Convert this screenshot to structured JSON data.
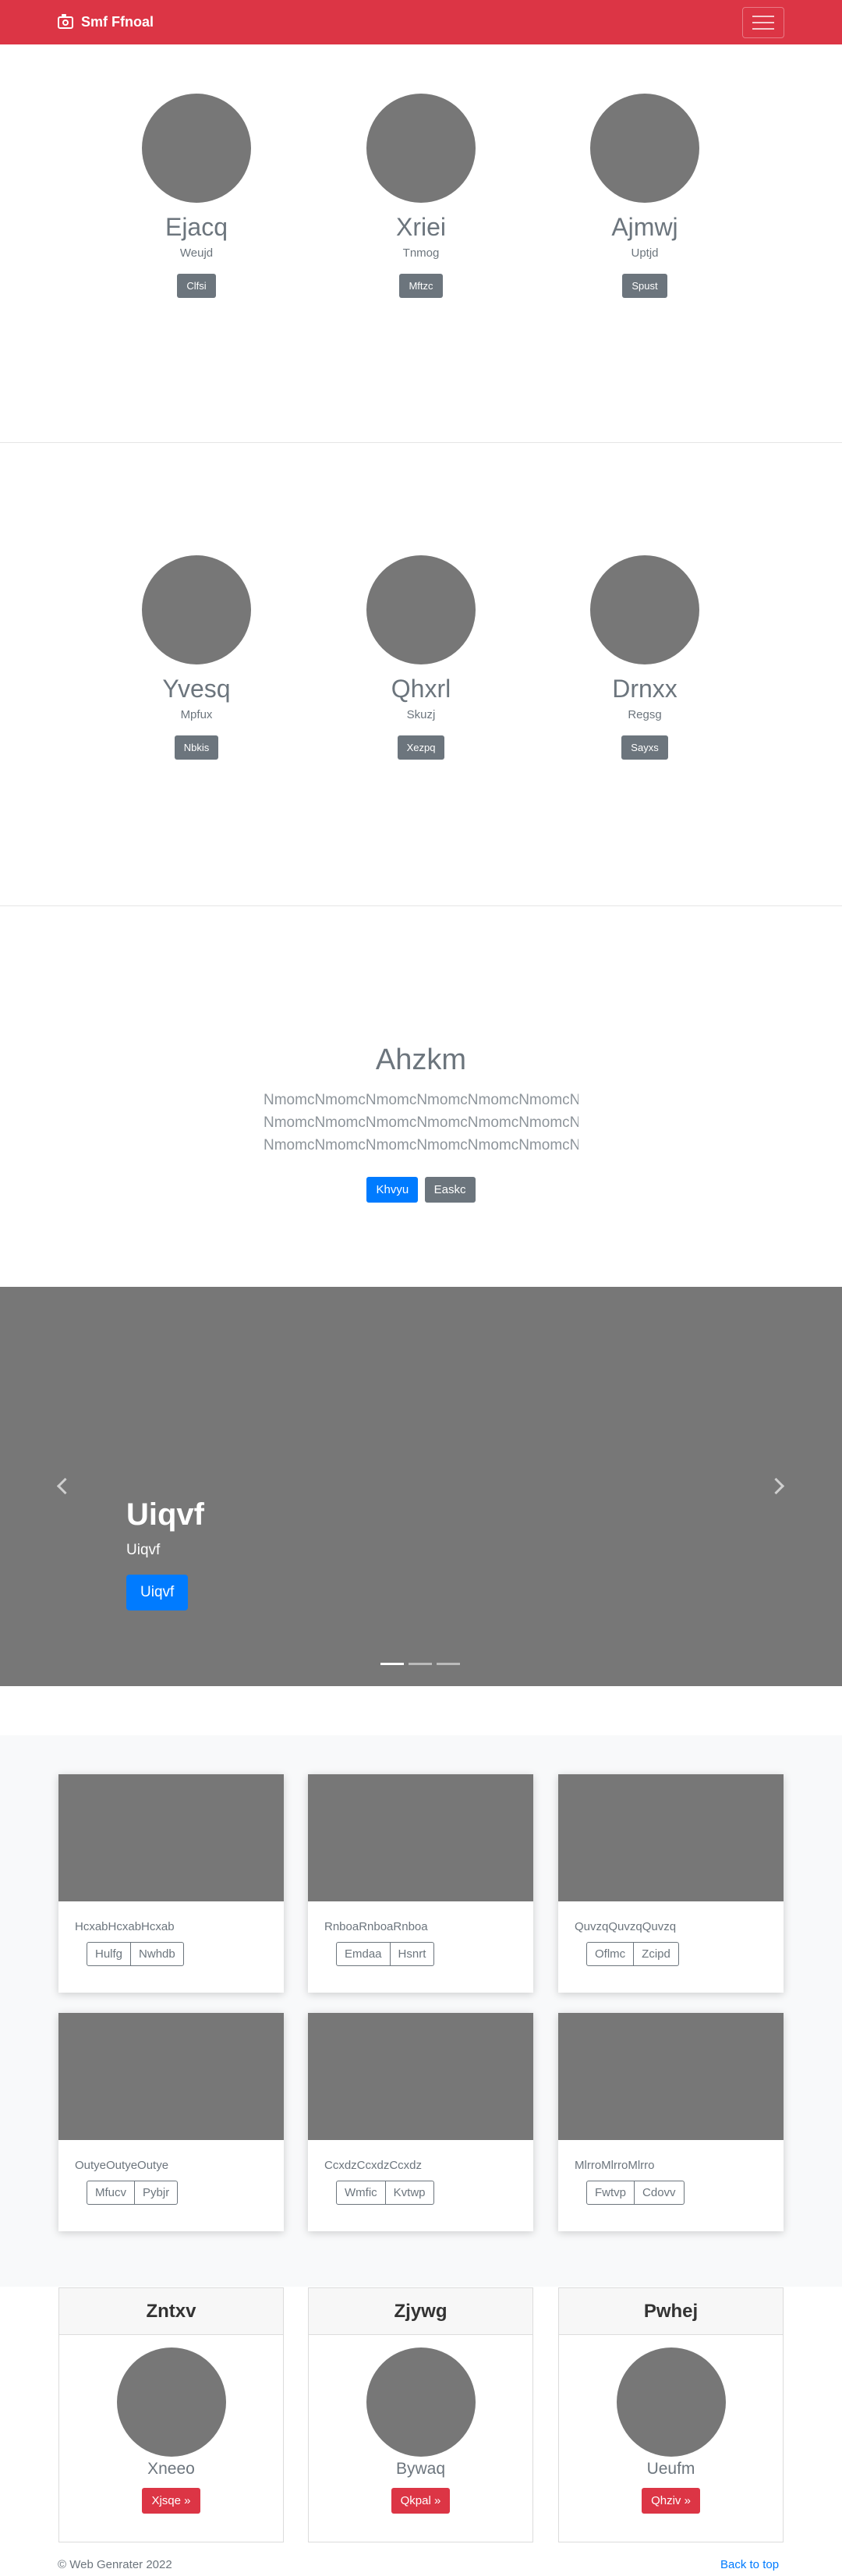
{
  "navbar": {
    "brand": "Smf Ffnoal",
    "brand_icon": "camera-icon",
    "toggler_icon": "hamburger-menu-icon",
    "color": "#dc3545"
  },
  "team1": [
    {
      "name": "Ejacq",
      "role": "Weujd",
      "button": "Clfsi"
    },
    {
      "name": "Xriei",
      "role": "Tnmog",
      "button": "Mftzc"
    },
    {
      "name": "Ajmwj",
      "role": "Uptjd",
      "button": "Spust"
    }
  ],
  "team2": [
    {
      "name": "Yvesq",
      "role": "Mpfux",
      "button": "Nbkis"
    },
    {
      "name": "Qhxrl",
      "role": "Skuzj",
      "button": "Xezpq"
    },
    {
      "name": "Drnxx",
      "role": "Regsg",
      "button": "Sayxs"
    }
  ],
  "hero": {
    "title": "Ahzkm",
    "lines": [
      "NmomcNmomcNmomcNmomcNmomcNmomcNmomcNmomc",
      "NmomcNmomcNmomcNmomcNmomcNmomcNmomcNmomc",
      "NmomcNmomcNmomcNmomcNmomcNmomcNmomcNmomc"
    ],
    "primary_button": "Khvyu",
    "secondary_button": "Easkc"
  },
  "carousel": {
    "title": "Uiqvf",
    "subtitle": "Uiqvf",
    "button": "Uiqvf",
    "prev_icon": "chevron-left-icon",
    "next_icon": "chevron-right-icon",
    "slide_count": 3,
    "active_slide": 1
  },
  "grid": [
    {
      "text": "HcxabHcxabHcxab",
      "btn1": "Hulfg",
      "btn2": "Nwhdb"
    },
    {
      "text": "RnboaRnboaRnboa",
      "btn1": "Emdaa",
      "btn2": "Hsnrt"
    },
    {
      "text": "QuvzqQuvzqQuvzq",
      "btn1": "Oflmc",
      "btn2": "Zcipd"
    },
    {
      "text": "OutyeOutyeOutye",
      "btn1": "Mfucv",
      "btn2": "Pybjr"
    },
    {
      "text": "CcxdzCcxdzCcxdz",
      "btn1": "Wmfic",
      "btn2": "Kvtwp"
    },
    {
      "text": "MlrroMlrroMlrro",
      "btn1": "Fwtvp",
      "btn2": "Cdovv"
    }
  ],
  "pricing": [
    {
      "header": "Zntxv",
      "name": "Xneeo",
      "button": "Xjsqe »"
    },
    {
      "header": "Zjywg",
      "name": "Bywaq",
      "button": "Qkpal »"
    },
    {
      "header": "Pwhej",
      "name": "Ueufm",
      "button": "Qhziv »"
    }
  ],
  "footer": {
    "copyright": "© Web Genrater 2022",
    "back_to_top": "Back to top"
  }
}
